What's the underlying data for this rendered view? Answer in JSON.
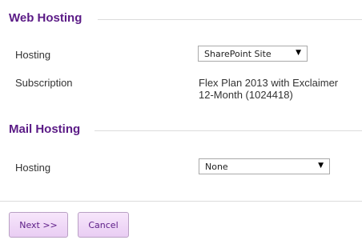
{
  "web_hosting": {
    "title": "Web Hosting",
    "hosting_label": "Hosting",
    "hosting_value": "SharePoint Site",
    "subscription_label": "Subscription",
    "subscription_line1": "Flex Plan 2013 with Exclaimer",
    "subscription_line2": "12-Month (1024418)"
  },
  "mail_hosting": {
    "title": "Mail Hosting",
    "hosting_label": "Hosting",
    "hosting_value": "None"
  },
  "buttons": {
    "next": "Next >>",
    "cancel": "Cancel"
  },
  "icons": {
    "dropdown_arrow": "▼"
  },
  "colors": {
    "heading": "#5b1b86",
    "button_bg": "#f0dbf7",
    "button_border": "#b9a0c4",
    "rule": "#dcdcdc"
  }
}
